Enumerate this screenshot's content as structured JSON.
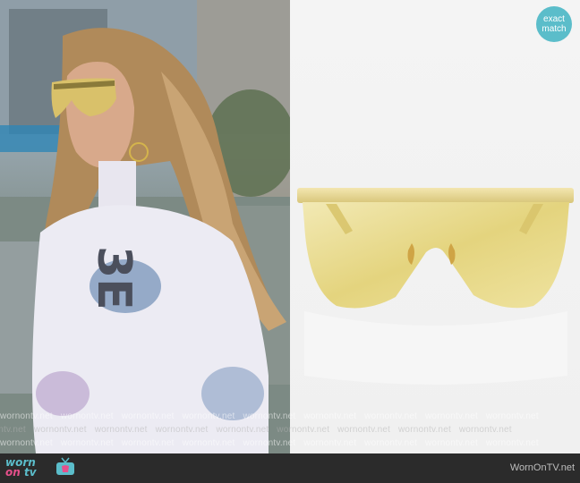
{
  "badge": {
    "line1": "exact",
    "line2": "match"
  },
  "watermark": {
    "text": "wornontv.net"
  },
  "footer": {
    "logo_word1": "worn",
    "logo_word2": "on",
    "logo_word3": "tv",
    "site": "WornOnTV.net"
  },
  "colors": {
    "badge": "#5bbdca",
    "footer_bg": "#2b2b2b",
    "logo_accent": "#e5508b",
    "lens_gold": "#e3d27a"
  }
}
